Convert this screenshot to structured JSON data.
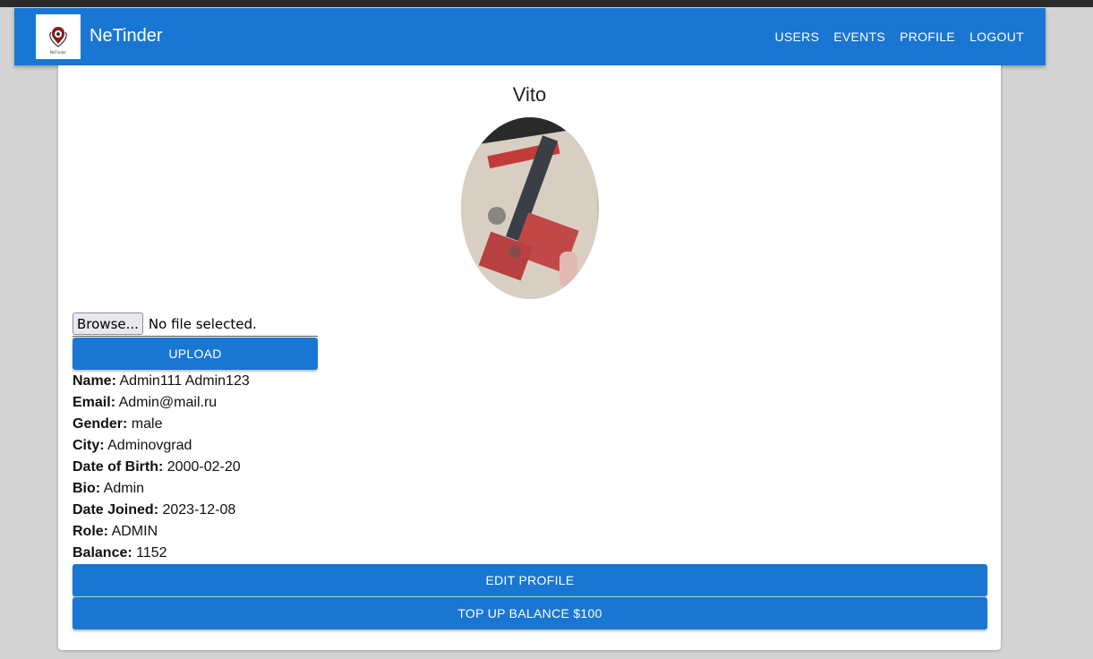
{
  "header": {
    "brand": "NeTinder",
    "logo_text": "NeTinder",
    "nav": [
      "USERS",
      "EVENTS",
      "PROFILE",
      "LOGOUT"
    ]
  },
  "profile": {
    "username": "Vito",
    "file_input": {
      "browse_label": "Browse...",
      "status": "No file selected."
    },
    "upload_label": "UPLOAD",
    "fields": [
      {
        "label": "Name:",
        "value": "Admin111 Admin123"
      },
      {
        "label": "Email:",
        "value": "Admin@mail.ru"
      },
      {
        "label": "Gender:",
        "value": "male"
      },
      {
        "label": "City:",
        "value": "Adminovgrad"
      },
      {
        "label": "Date of Birth:",
        "value": "2000-02-20"
      },
      {
        "label": "Bio:",
        "value": "Admin"
      },
      {
        "label": "Date Joined:",
        "value": "2023-12-08"
      },
      {
        "label": "Role:",
        "value": "ADMIN"
      },
      {
        "label": "Balance:",
        "value": "1152"
      }
    ],
    "edit_label": "EDIT PROFILE",
    "topup_label": "TOP UP BALANCE $100"
  },
  "colors": {
    "primary": "#1976d2",
    "background": "#d3d3d3"
  }
}
